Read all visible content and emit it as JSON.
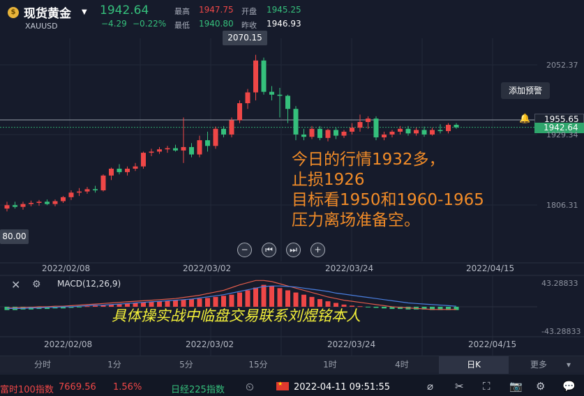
{
  "header": {
    "instrument_name": "现货黄金",
    "symbol": "XAUUSD",
    "last_price": "1942.64",
    "change": "−4.29",
    "change_pct": "−0.22%",
    "high_label": "最高",
    "high_value": "1947.75",
    "open_label": "开盘",
    "open_value": "1945.25",
    "low_label": "最低",
    "low_value": "1940.80",
    "prev_close_label": "昨收",
    "prev_close_value": "1946.93"
  },
  "chart": {
    "peak_tooltip": "2070.15",
    "left_tooltip": "80.00",
    "alert_button": "添加预警",
    "price_line_label": "1955.65",
    "current_price_label": "1942.64",
    "y_axis_labels": [
      "2052.37",
      "1929.34",
      "1806.31"
    ],
    "x_axis_labels": [
      "2022/02/08",
      "2022/03/02",
      "2022/03/24",
      "2022/04/15"
    ],
    "annotation_lines": [
      "今日的行情1932多，",
      "止损1926",
      "目标看1950和1960-1965",
      "压力离场准备空。"
    ],
    "nav_buttons": [
      "−",
      "⏮",
      "⏭",
      "+"
    ]
  },
  "chart_data": {
    "type": "candlestick",
    "y_ticks": [
      2052.37,
      1929.34,
      1806.31
    ],
    "price_line": 1955.65,
    "current_price": 1942.64,
    "candles": [
      {
        "o": 1800,
        "h": 1812,
        "l": 1795,
        "c": 1806
      },
      {
        "o": 1806,
        "h": 1812,
        "l": 1800,
        "c": 1803
      },
      {
        "o": 1803,
        "h": 1812,
        "l": 1798,
        "c": 1808
      },
      {
        "o": 1808,
        "h": 1814,
        "l": 1804,
        "c": 1810
      },
      {
        "o": 1810,
        "h": 1815,
        "l": 1805,
        "c": 1812
      },
      {
        "o": 1812,
        "h": 1816,
        "l": 1806,
        "c": 1808
      },
      {
        "o": 1808,
        "h": 1816,
        "l": 1804,
        "c": 1813
      },
      {
        "o": 1813,
        "h": 1822,
        "l": 1810,
        "c": 1820
      },
      {
        "o": 1820,
        "h": 1832,
        "l": 1815,
        "c": 1828
      },
      {
        "o": 1828,
        "h": 1836,
        "l": 1822,
        "c": 1830
      },
      {
        "o": 1830,
        "h": 1838,
        "l": 1826,
        "c": 1834
      },
      {
        "o": 1834,
        "h": 1840,
        "l": 1828,
        "c": 1832
      },
      {
        "o": 1832,
        "h": 1860,
        "l": 1830,
        "c": 1858
      },
      {
        "o": 1858,
        "h": 1872,
        "l": 1850,
        "c": 1870
      },
      {
        "o": 1870,
        "h": 1878,
        "l": 1860,
        "c": 1864
      },
      {
        "o": 1864,
        "h": 1874,
        "l": 1858,
        "c": 1870
      },
      {
        "o": 1870,
        "h": 1880,
        "l": 1866,
        "c": 1874
      },
      {
        "o": 1874,
        "h": 1900,
        "l": 1870,
        "c": 1898
      },
      {
        "o": 1898,
        "h": 1905,
        "l": 1892,
        "c": 1900
      },
      {
        "o": 1900,
        "h": 1908,
        "l": 1896,
        "c": 1904
      },
      {
        "o": 1904,
        "h": 1910,
        "l": 1898,
        "c": 1906
      },
      {
        "o": 1906,
        "h": 1912,
        "l": 1900,
        "c": 1902
      },
      {
        "o": 1902,
        "h": 1960,
        "l": 1880,
        "c": 1908
      },
      {
        "o": 1908,
        "h": 1915,
        "l": 1890,
        "c": 1895
      },
      {
        "o": 1895,
        "h": 1928,
        "l": 1890,
        "c": 1920
      },
      {
        "o": 1920,
        "h": 1935,
        "l": 1900,
        "c": 1910
      },
      {
        "o": 1910,
        "h": 1944,
        "l": 1905,
        "c": 1940
      },
      {
        "o": 1940,
        "h": 1945,
        "l": 1925,
        "c": 1930
      },
      {
        "o": 1930,
        "h": 1960,
        "l": 1925,
        "c": 1955
      },
      {
        "o": 1955,
        "h": 1990,
        "l": 1950,
        "c": 1985
      },
      {
        "o": 1985,
        "h": 2010,
        "l": 1975,
        "c": 2004
      },
      {
        "o": 2004,
        "h": 2070,
        "l": 1990,
        "c": 2060
      },
      {
        "o": 2060,
        "h": 2065,
        "l": 2000,
        "c": 2005
      },
      {
        "o": 2005,
        "h": 2015,
        "l": 1990,
        "c": 2000
      },
      {
        "o": 2000,
        "h": 2012,
        "l": 1960,
        "c": 1998
      },
      {
        "o": 1998,
        "h": 2000,
        "l": 1950,
        "c": 1975
      },
      {
        "o": 1975,
        "h": 1980,
        "l": 1920,
        "c": 1930
      },
      {
        "o": 1930,
        "h": 1940,
        "l": 1920,
        "c": 1926
      },
      {
        "o": 1926,
        "h": 1945,
        "l": 1922,
        "c": 1940
      },
      {
        "o": 1940,
        "h": 1945,
        "l": 1920,
        "c": 1924
      },
      {
        "o": 1924,
        "h": 1940,
        "l": 1918,
        "c": 1938
      },
      {
        "o": 1938,
        "h": 1942,
        "l": 1922,
        "c": 1928
      },
      {
        "o": 1928,
        "h": 1938,
        "l": 1924,
        "c": 1935
      },
      {
        "o": 1935,
        "h": 1950,
        "l": 1930,
        "c": 1942
      },
      {
        "o": 1942,
        "h": 1965,
        "l": 1935,
        "c": 1952
      },
      {
        "o": 1952,
        "h": 1962,
        "l": 1940,
        "c": 1958
      },
      {
        "o": 1958,
        "h": 1962,
        "l": 1920,
        "c": 1925
      },
      {
        "o": 1925,
        "h": 1935,
        "l": 1920,
        "c": 1930
      },
      {
        "o": 1930,
        "h": 1938,
        "l": 1925,
        "c": 1935
      },
      {
        "o": 1935,
        "h": 1945,
        "l": 1930,
        "c": 1940
      },
      {
        "o": 1940,
        "h": 1945,
        "l": 1928,
        "c": 1932
      },
      {
        "o": 1932,
        "h": 1942,
        "l": 1928,
        "c": 1938
      },
      {
        "o": 1938,
        "h": 1944,
        "l": 1926,
        "c": 1930
      },
      {
        "o": 1930,
        "h": 1942,
        "l": 1928,
        "c": 1938
      },
      {
        "o": 1938,
        "h": 1948,
        "l": 1932,
        "c": 1936
      },
      {
        "o": 1936,
        "h": 1950,
        "l": 1932,
        "c": 1947
      },
      {
        "o": 1947,
        "h": 1950,
        "l": 1940,
        "c": 1942.64
      }
    ],
    "macd": {
      "title": "MACD(12,26,9)",
      "ylim": [
        -43.28833,
        43.28833
      ],
      "y_ticks": [
        "43.28833",
        "-43.28833"
      ],
      "hist": [
        -6,
        -6,
        -5,
        -5,
        -4,
        -4,
        -3,
        -3,
        -2,
        -1,
        1,
        2,
        3,
        4,
        5,
        6,
        7,
        8,
        9,
        10,
        11,
        12,
        13,
        14,
        15,
        16,
        18,
        20,
        22,
        26,
        30,
        35,
        40,
        38,
        34,
        30,
        26,
        22,
        18,
        14,
        10,
        7,
        4,
        2,
        1,
        -1,
        -2,
        -3,
        -4,
        -4,
        -5,
        -5,
        -5,
        -6,
        -6,
        -6,
        -6
      ],
      "dif": [
        -2,
        -2,
        -1,
        -1,
        0,
        0,
        1,
        1,
        2,
        3,
        4,
        5,
        6,
        7,
        8,
        9,
        10,
        11,
        12,
        13,
        14,
        15,
        17,
        19,
        21,
        24,
        27,
        30,
        35,
        40,
        44,
        48,
        48,
        46,
        42,
        38,
        34,
        30,
        26,
        22,
        18,
        15,
        12,
        10,
        8,
        6,
        4,
        2,
        0,
        -1,
        -2,
        -3,
        -4,
        -5,
        -5,
        -5,
        -5
      ],
      "dea": [
        -3,
        -3,
        -3,
        -2,
        -2,
        -1,
        -1,
        0,
        0,
        1,
        2,
        3,
        3,
        4,
        5,
        6,
        7,
        8,
        9,
        10,
        11,
        12,
        13,
        14,
        16,
        18,
        20,
        22,
        25,
        28,
        31,
        34,
        37,
        38,
        38,
        37,
        36,
        34,
        32,
        30,
        28,
        25,
        23,
        21,
        19,
        17,
        15,
        13,
        11,
        9,
        7,
        6,
        5,
        4,
        3,
        2,
        1
      ]
    }
  },
  "macd_panel": {
    "title": "MACD(12,26,9)",
    "annotation": "具体操实战中临盘交易联系刘煜铭本人",
    "y_top": "43.28833",
    "y_bottom": "-43.28833",
    "x_axis_labels": [
      "2022/02/08",
      "2022/03/02",
      "2022/03/24",
      "2022/04/15"
    ]
  },
  "timeframes": [
    "分时",
    "1分",
    "5分",
    "15分",
    "1时",
    "4时",
    "日K",
    "更多"
  ],
  "active_timeframe": "日K",
  "status_bar": {
    "index1_name": "富时100指数",
    "index1_value": "7669.56",
    "index1_change": "1.56%",
    "index2_name": "日经225指数",
    "datetime": "2022-04-11  09:51:55"
  },
  "colors": {
    "up": "#ef4747",
    "down": "#35c07c",
    "annotation": "#f28c28",
    "macd_note": "#f3f03a",
    "background": "#161b2b"
  }
}
